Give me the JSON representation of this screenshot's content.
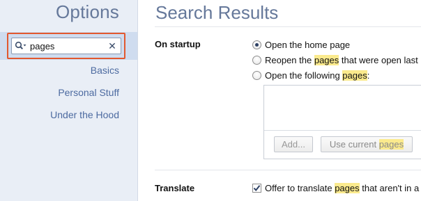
{
  "sidebar": {
    "title": "Options",
    "search": {
      "value": "pages",
      "placeholder": ""
    },
    "items": [
      {
        "label": "Basics"
      },
      {
        "label": "Personal Stuff"
      },
      {
        "label": "Under the Hood"
      }
    ]
  },
  "main": {
    "title": "Search Results",
    "startup": {
      "label": "On startup",
      "options": [
        {
          "text": "Open the home page",
          "checked": true
        },
        {
          "pre": "Reopen the ",
          "hl": "pages",
          "post": " that were open last"
        },
        {
          "pre": "Open the following ",
          "hl": "pages",
          "post": ":"
        }
      ],
      "add_button": "Add...",
      "use_current_pre": "Use current ",
      "use_current_hl": "pages"
    },
    "translate": {
      "label": "Translate",
      "pre": "Offer to translate ",
      "hl": "pages",
      "post": " that aren't in a",
      "checked": true
    }
  },
  "colors": {
    "sidebar_bg": "#e9eef6",
    "search_band": "#cfdcef",
    "focus_outline": "#e2582f",
    "highlight": "#fbea8d",
    "title_text": "#65789a",
    "nav_link": "#4c6aa0"
  }
}
